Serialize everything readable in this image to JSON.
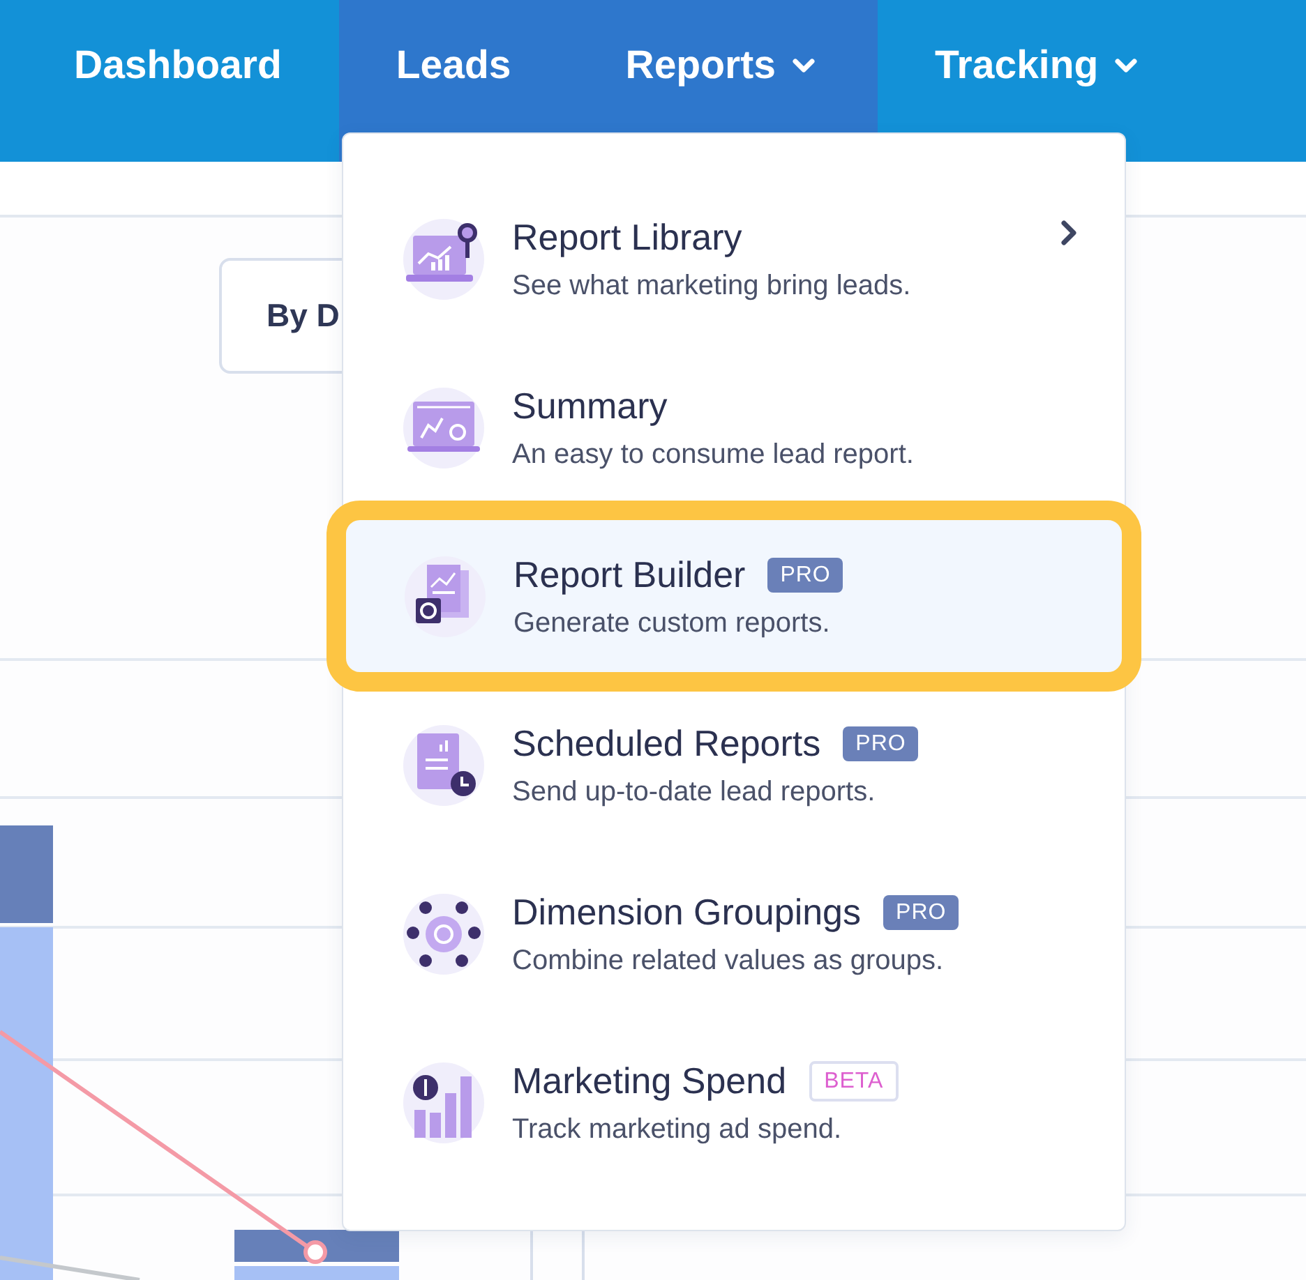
{
  "nav": {
    "items": [
      {
        "label": "Dashboard",
        "active": false,
        "has_caret": false
      },
      {
        "label": "Leads",
        "active": true,
        "has_caret": false
      },
      {
        "label": "Reports",
        "active": true,
        "has_caret": true
      },
      {
        "label": "Tracking",
        "active": false,
        "has_caret": true
      }
    ]
  },
  "toolbar": {
    "button": "By D"
  },
  "menu": {
    "items": [
      {
        "title": "Report Library",
        "description": "See what marketing bring leads.",
        "highlighted": false,
        "has_submenu": true
      },
      {
        "title": "Summary",
        "description": "An easy to consume lead report.",
        "highlighted": false,
        "has_submenu": false
      },
      {
        "title": "Report Builder",
        "badge": {
          "text": "PRO",
          "kind": "pro"
        },
        "description": "Generate custom reports.",
        "highlighted": true,
        "has_submenu": false
      },
      {
        "title": "Scheduled Reports",
        "badge": {
          "text": "PRO",
          "kind": "pro"
        },
        "description": "Send up-to-date lead reports.",
        "highlighted": false,
        "has_submenu": false
      },
      {
        "title": "Dimension Groupings",
        "badge": {
          "text": "PRO",
          "kind": "pro"
        },
        "description": "Combine related values as groups.",
        "highlighted": false,
        "has_submenu": false
      },
      {
        "title": "Marketing Spend",
        "badge": {
          "text": "BETA",
          "kind": "beta"
        },
        "description": "Track marketing ad spend.",
        "highlighted": false,
        "has_submenu": false
      }
    ]
  }
}
